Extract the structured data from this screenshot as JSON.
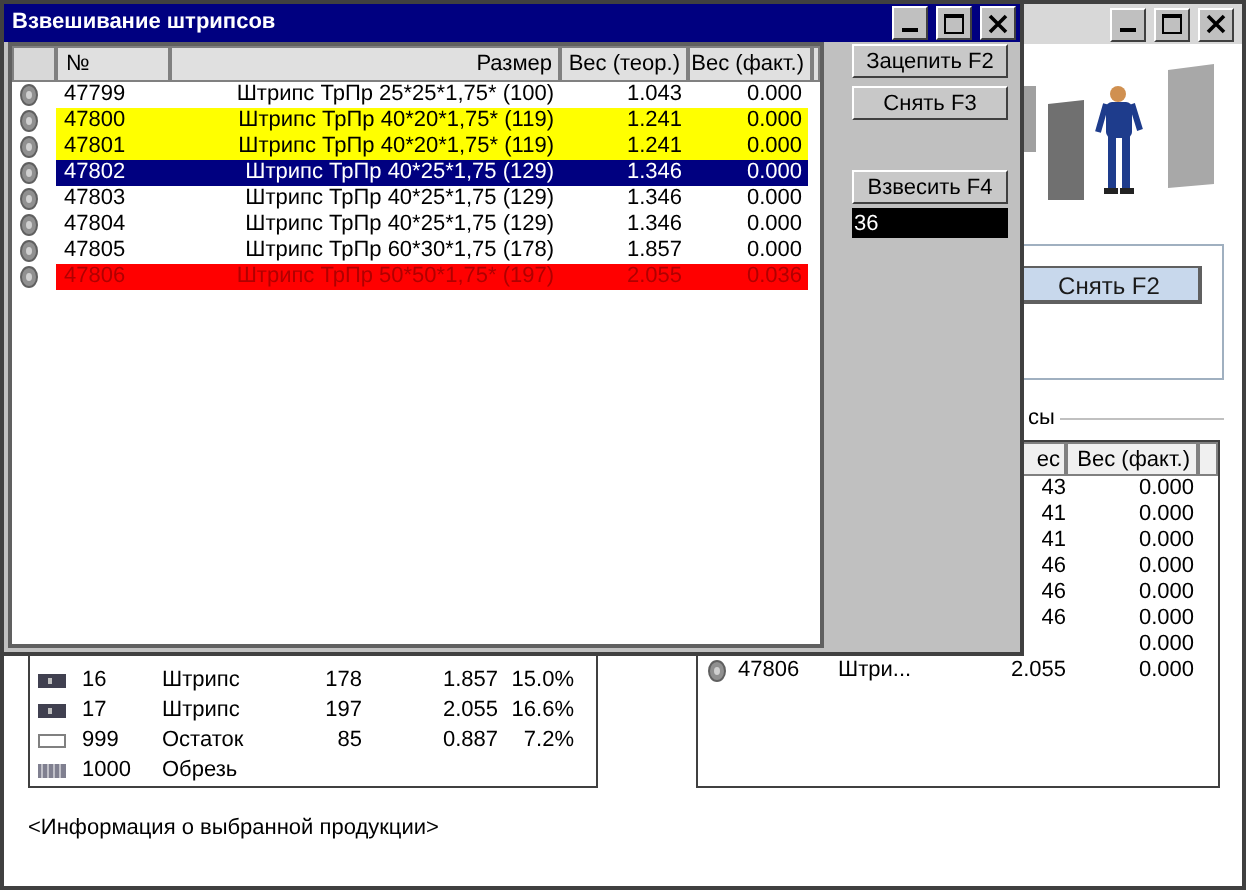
{
  "main_window": {
    "group_button": "Снять F2",
    "section_label": "сы",
    "legend_table": {
      "rows": [
        {
          "kind": "strip",
          "id": "16",
          "name": "Штрипс",
          "count": "178",
          "weight": "1.857",
          "percent": "15.0%"
        },
        {
          "kind": "strip",
          "id": "17",
          "name": "Штрипс",
          "count": "197",
          "weight": "2.055",
          "percent": "16.6%"
        },
        {
          "kind": "remainder",
          "id": "999",
          "name": "Остаток",
          "count": "85",
          "weight": "0.887",
          "percent": "7.2%"
        },
        {
          "kind": "scrap",
          "id": "1000",
          "name": "Обрезь"
        }
      ]
    },
    "strips_table": {
      "columns": [
        "ес",
        "Вес (факт.)"
      ],
      "rows": [
        {
          "weight_theor": "43",
          "weight_fact": "0.000"
        },
        {
          "weight_theor": "41",
          "weight_fact": "0.000"
        },
        {
          "weight_theor": "41",
          "weight_fact": "0.000"
        },
        {
          "weight_theor": "46",
          "weight_fact": "0.000"
        },
        {
          "weight_theor": "46",
          "weight_fact": "0.000"
        },
        {
          "weight_theor": "46",
          "weight_fact": "0.000"
        },
        {
          "weight_fact": "0.000"
        },
        {
          "number": "47806",
          "name": "Штри...",
          "weight_theor": "2.055",
          "weight_fact": "0.000"
        }
      ]
    },
    "info": "<Информация о выбранной продукции>"
  },
  "dialog": {
    "title": "Взвешивание штрипсов",
    "table": {
      "columns": [
        "№",
        "Размер",
        "Вес (теор.)",
        "Вес (факт.)"
      ],
      "rows": [
        {
          "number": "47799",
          "size": "Штрипс ТрПр 25*25*1,75* (100)",
          "weight_theor": "1.043",
          "weight_fact": "0.000",
          "color": "#ffffff",
          "selected": false
        },
        {
          "number": "47800",
          "size": "Штрипс ТрПр 40*20*1,75* (119)",
          "weight_theor": "1.241",
          "weight_fact": "0.000",
          "color": "#ffff00",
          "selected": false
        },
        {
          "number": "47801",
          "size": "Штрипс ТрПр 40*20*1,75* (119)",
          "weight_theor": "1.241",
          "weight_fact": "0.000",
          "color": "#ffff00",
          "selected": false
        },
        {
          "number": "47802",
          "size": "Штрипс ТрПр 40*25*1,75 (129)",
          "weight_theor": "1.346",
          "weight_fact": "0.000",
          "selected": true
        },
        {
          "number": "47803",
          "size": "Штрипс ТрПр 40*25*1,75 (129)",
          "weight_theor": "1.346",
          "weight_fact": "0.000",
          "color": "#ffffff",
          "selected": false
        },
        {
          "number": "47804",
          "size": "Штрипс ТрПр 40*25*1,75 (129)",
          "weight_theor": "1.346",
          "weight_fact": "0.000",
          "color": "#ffffff",
          "selected": false
        },
        {
          "number": "47805",
          "size": "Штрипс ТрПр 60*30*1,75 (178)",
          "weight_theor": "1.857",
          "weight_fact": "0.000",
          "color": "#ffffff",
          "selected": false
        },
        {
          "number": "47806",
          "size": "Штрипс ТрПр 50*50*1,75* (197)",
          "weight_theor": "2.055",
          "weight_fact": "0.036",
          "color": "#ff0000",
          "selected": false
        }
      ]
    },
    "buttons": [
      "Зацепить F2",
      "Снять F3",
      "Взвесить F4"
    ],
    "weight_field": "36"
  }
}
